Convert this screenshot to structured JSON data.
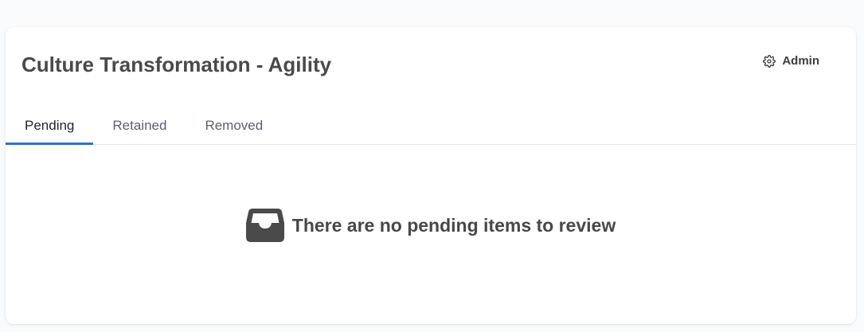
{
  "header": {
    "title": "Culture Transformation - Agility",
    "admin_label": "Admin",
    "admin_icon": "gear-icon"
  },
  "tabs": [
    {
      "label": "Pending",
      "active": true
    },
    {
      "label": "Retained",
      "active": false
    },
    {
      "label": "Removed",
      "active": false
    }
  ],
  "empty_state": {
    "icon": "inbox-icon",
    "message": "There are no pending items to review"
  },
  "colors": {
    "accent": "#2f6fd6",
    "title": "#4a4a4a",
    "tab_inactive": "#5b6170",
    "tab_active": "#1e2230",
    "icon": "#4a4a4a"
  }
}
